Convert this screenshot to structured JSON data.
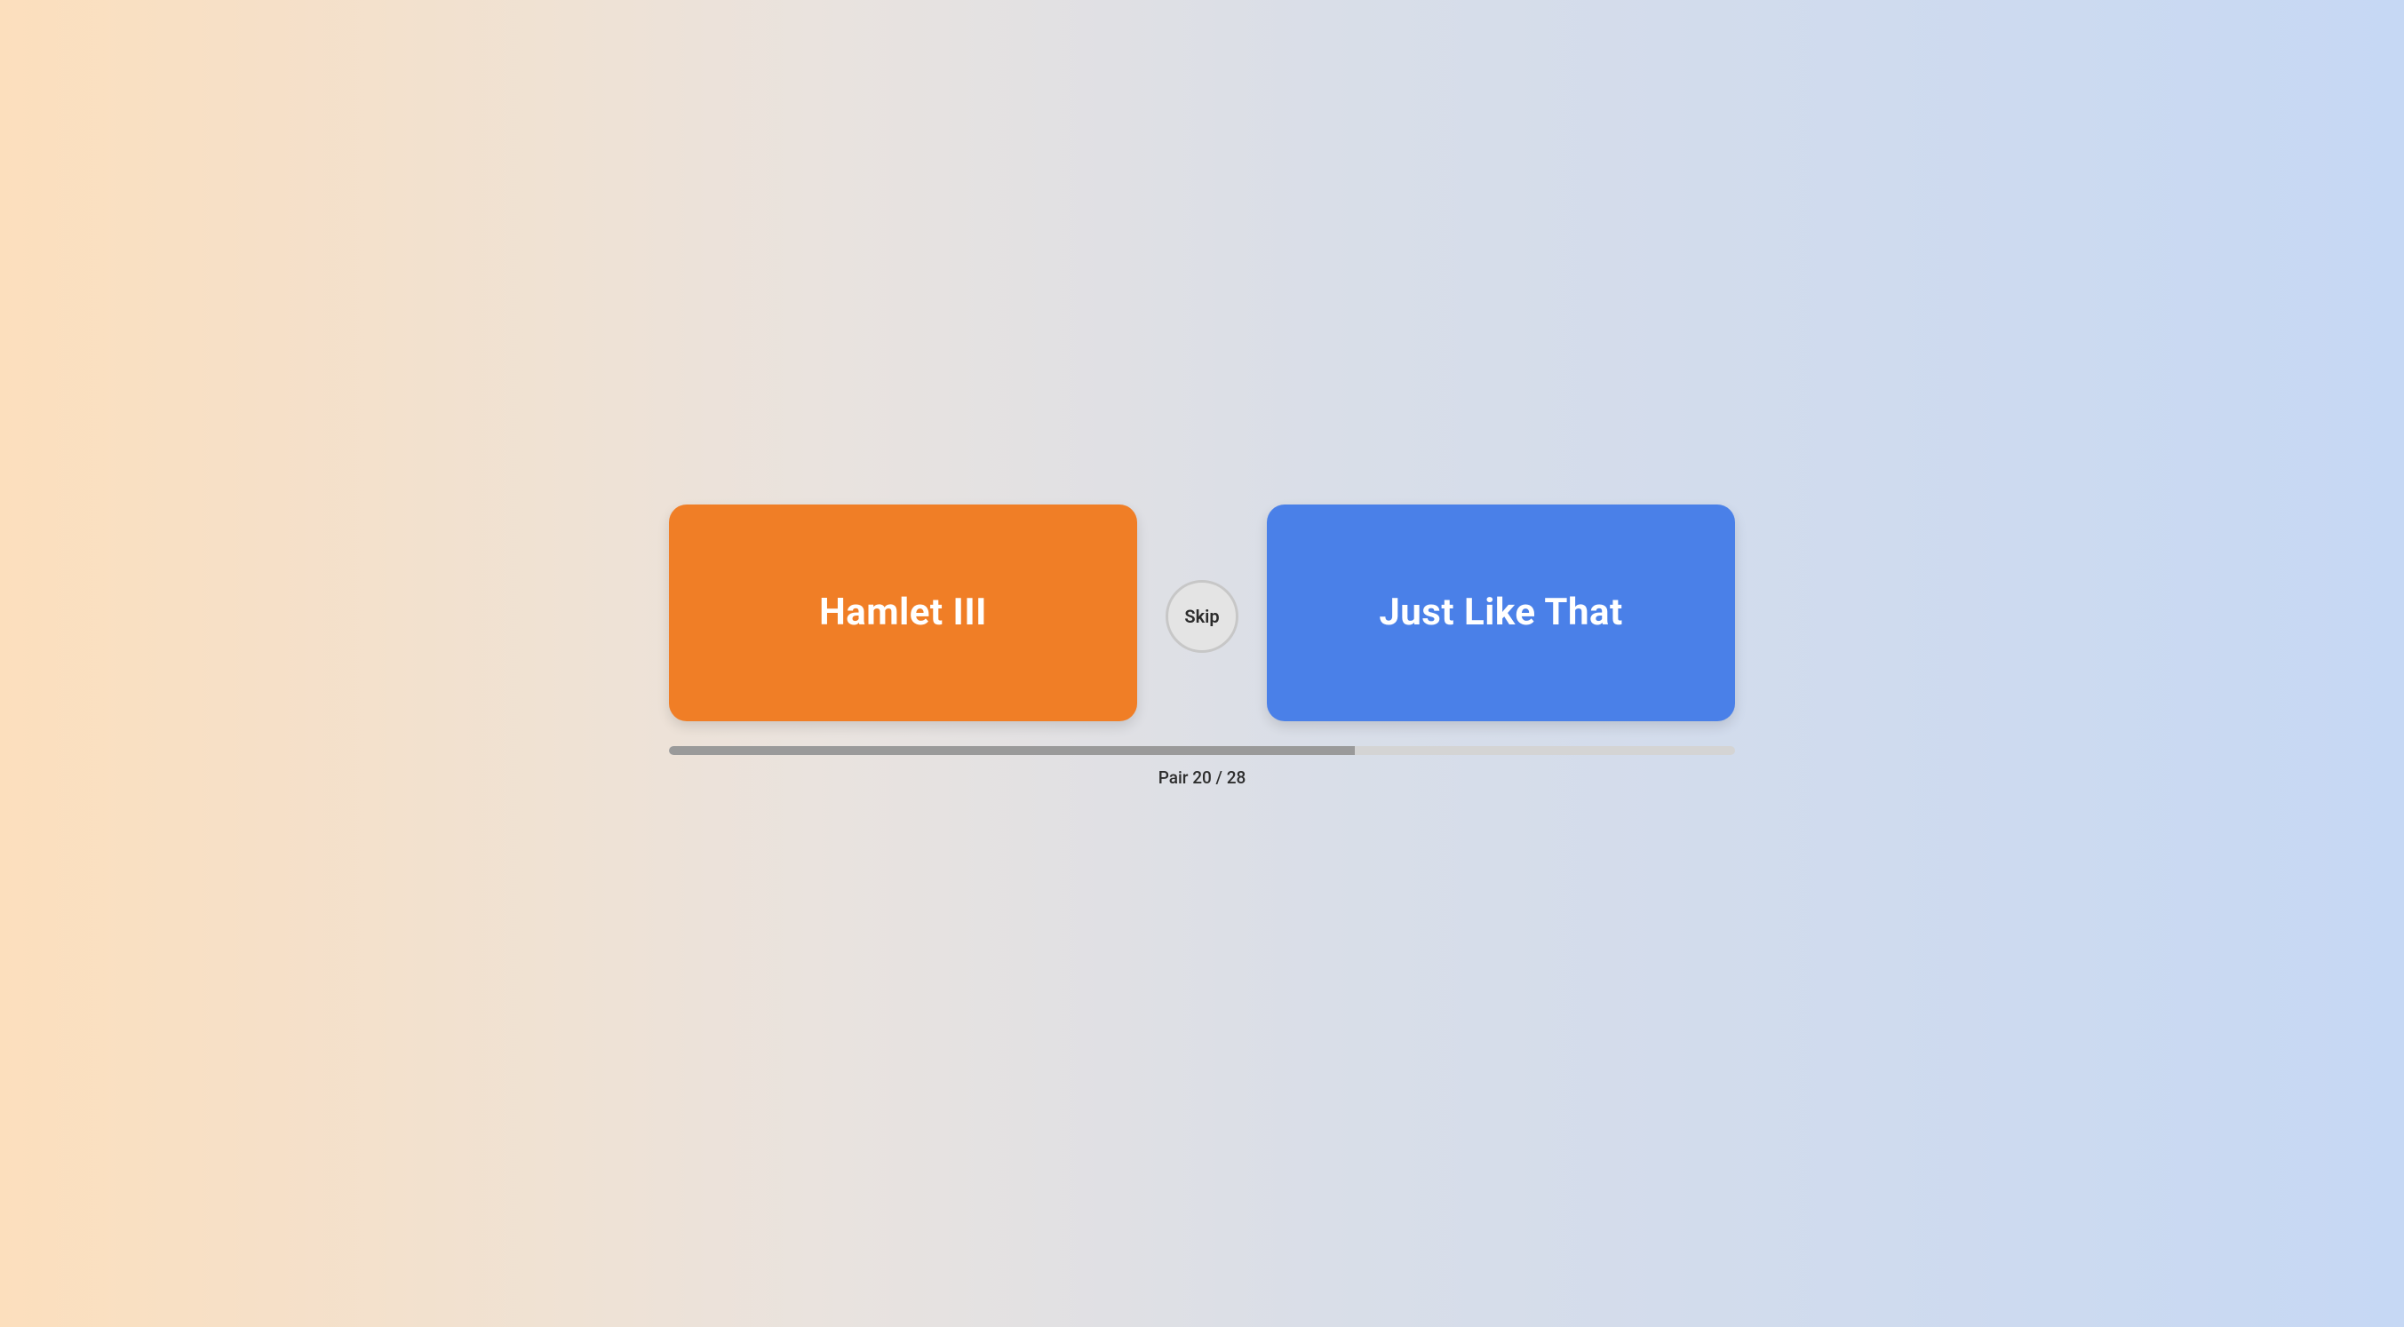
{
  "choices": {
    "left": {
      "label": "Hamlet III",
      "color": "#f07e26"
    },
    "right": {
      "label": "Just Like That",
      "color": "#4a80e8"
    }
  },
  "skip": {
    "label": "Skip"
  },
  "progress": {
    "current": 20,
    "total": 28,
    "label": "Pair 20 / 28",
    "percent": 64.3
  }
}
